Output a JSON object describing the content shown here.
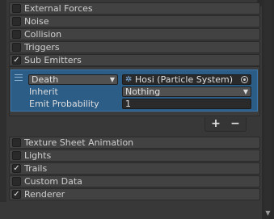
{
  "modules_top": [
    {
      "label": "External Forces",
      "checked": false
    },
    {
      "label": "Noise",
      "checked": false
    },
    {
      "label": "Collision",
      "checked": false
    },
    {
      "label": "Triggers",
      "checked": false
    },
    {
      "label": "Sub Emitters",
      "checked": true
    }
  ],
  "sub_emitters": {
    "item": {
      "trigger": "Death",
      "system": "Hosi (Particle System)",
      "inherit_label": "Inherit",
      "inherit_value": "Nothing",
      "emit_probability_label": "Emit Probability",
      "emit_probability_value": "1"
    },
    "add_label": "+",
    "remove_label": "−"
  },
  "modules_bottom": [
    {
      "label": "Texture Sheet Animation",
      "checked": false
    },
    {
      "label": "Lights",
      "checked": false
    },
    {
      "label": "Trails",
      "checked": true
    },
    {
      "label": "Custom Data",
      "checked": false
    },
    {
      "label": "Renderer",
      "checked": true
    }
  ],
  "icons": {
    "check": "✓",
    "dropdown_arrow": "▼",
    "particle_system": "particle-system-icon",
    "object_picker": "object-picker-icon"
  },
  "colors": {
    "selection": "#2c5d87",
    "panel": "#383838"
  }
}
